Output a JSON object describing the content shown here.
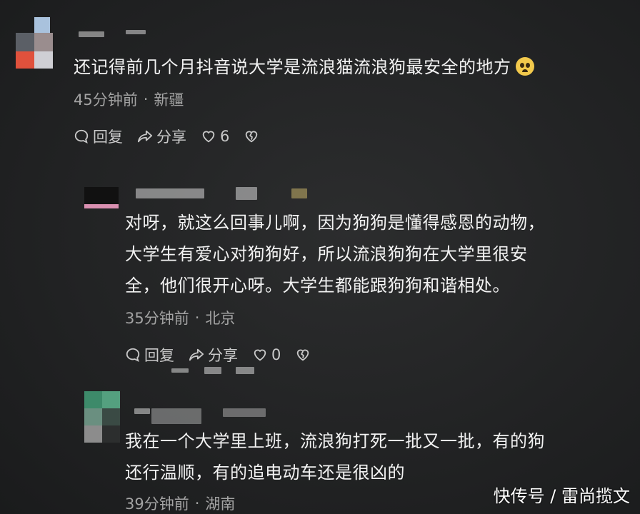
{
  "comments": [
    {
      "text": "还记得前几个月抖音说大学是流浪猫流浪狗最安全的地方",
      "emoji": "grimacing-face",
      "time": "45分钟前",
      "separator": "·",
      "location": "新疆",
      "reply_label": "回复",
      "share_label": "分享",
      "like_count": "6"
    },
    {
      "text": "对呀，就这么回事儿啊，因为狗狗是懂得感恩的动物，大学生有爱心对狗狗好，所以流浪狗狗在大学里很安全，他们很开心呀。大学生都能跟狗狗和谐相处。",
      "lines": [
        "对呀，就这么回事儿啊，因为狗狗是懂得感恩的动物，",
        "大学生有爱心对狗狗好，所以流浪狗狗在大学里很安",
        "全，他们很开心呀。大学生都能跟狗狗和谐相处。"
      ],
      "time": "35分钟前",
      "separator": "·",
      "location": "北京",
      "reply_label": "回复",
      "share_label": "分享",
      "like_count": "0"
    },
    {
      "text": "我在一个大学里上班，流浪狗打死一批又一批，有的狗还行温顺，有的追电动车还是很凶的",
      "lines": [
        "我在一个大学里上班，流浪狗打死一批又一批，有的狗",
        "还行温顺，有的追电动车还是很凶的"
      ],
      "time": "39分钟前",
      "separator": "·",
      "location": "湖南"
    }
  ],
  "watermark": "快传号 / 雷尚揽文",
  "colors": {
    "background": "#222324",
    "text": "#f2f2f2",
    "meta": "#a3a3a3"
  }
}
